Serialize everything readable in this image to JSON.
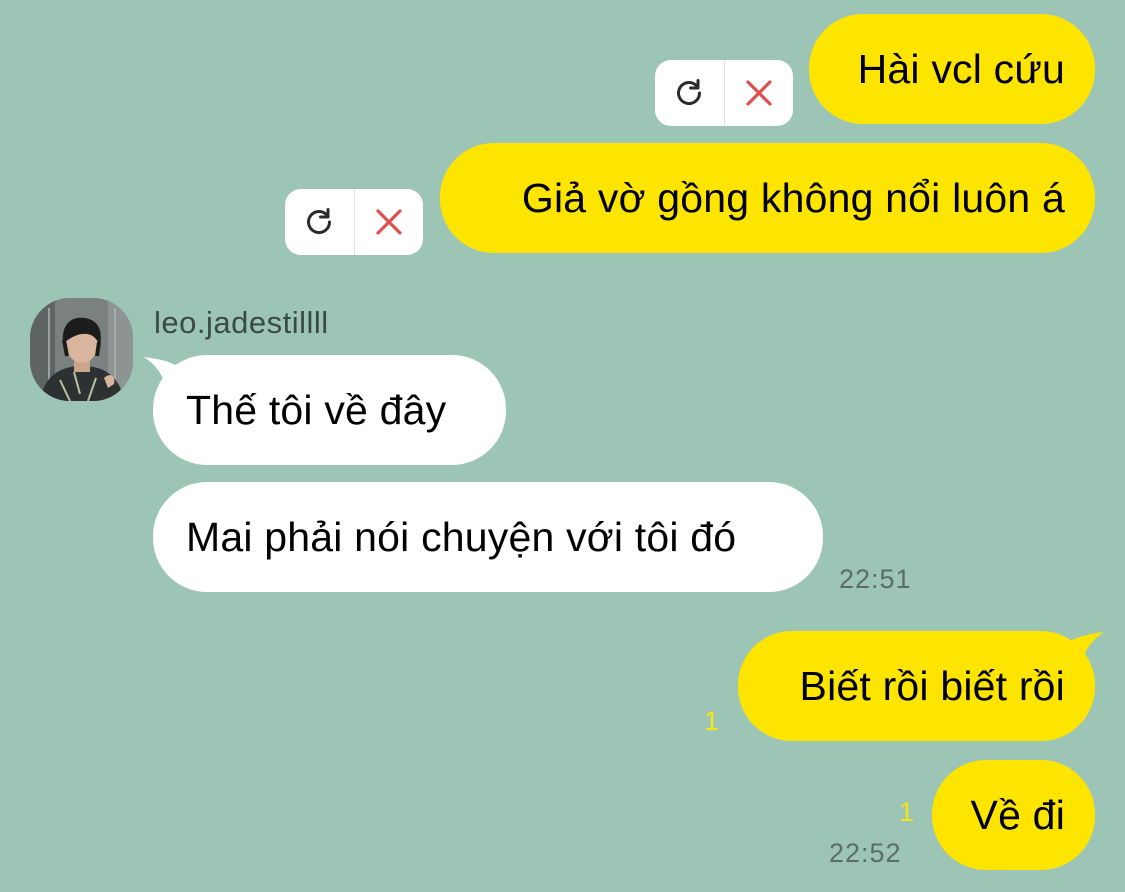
{
  "contact": {
    "username": "leo.jadestillll"
  },
  "messages": [
    {
      "side": "me",
      "text": "Hài vcl cứu",
      "status": "failed"
    },
    {
      "side": "me",
      "text": "Giả vờ gồng không nổi luôn á",
      "status": "failed"
    },
    {
      "side": "them",
      "text": "Thế tôi về đây"
    },
    {
      "side": "them",
      "text": "Mai phải nói chuyện với tôi đó",
      "time": "22:51"
    },
    {
      "side": "me",
      "text": "Biết rồi biết rồi",
      "unread": "1"
    },
    {
      "side": "me",
      "text": "Về đi",
      "unread": "1",
      "time": "22:52"
    }
  ],
  "icons": {
    "retry": "refresh-icon",
    "delete": "close-icon"
  },
  "colors": {
    "background": "#9dc5b5",
    "my_bubble": "#fee500",
    "their_bubble": "#ffffff",
    "unread_count": "#f6e318",
    "delete_icon": "#e0504a"
  }
}
